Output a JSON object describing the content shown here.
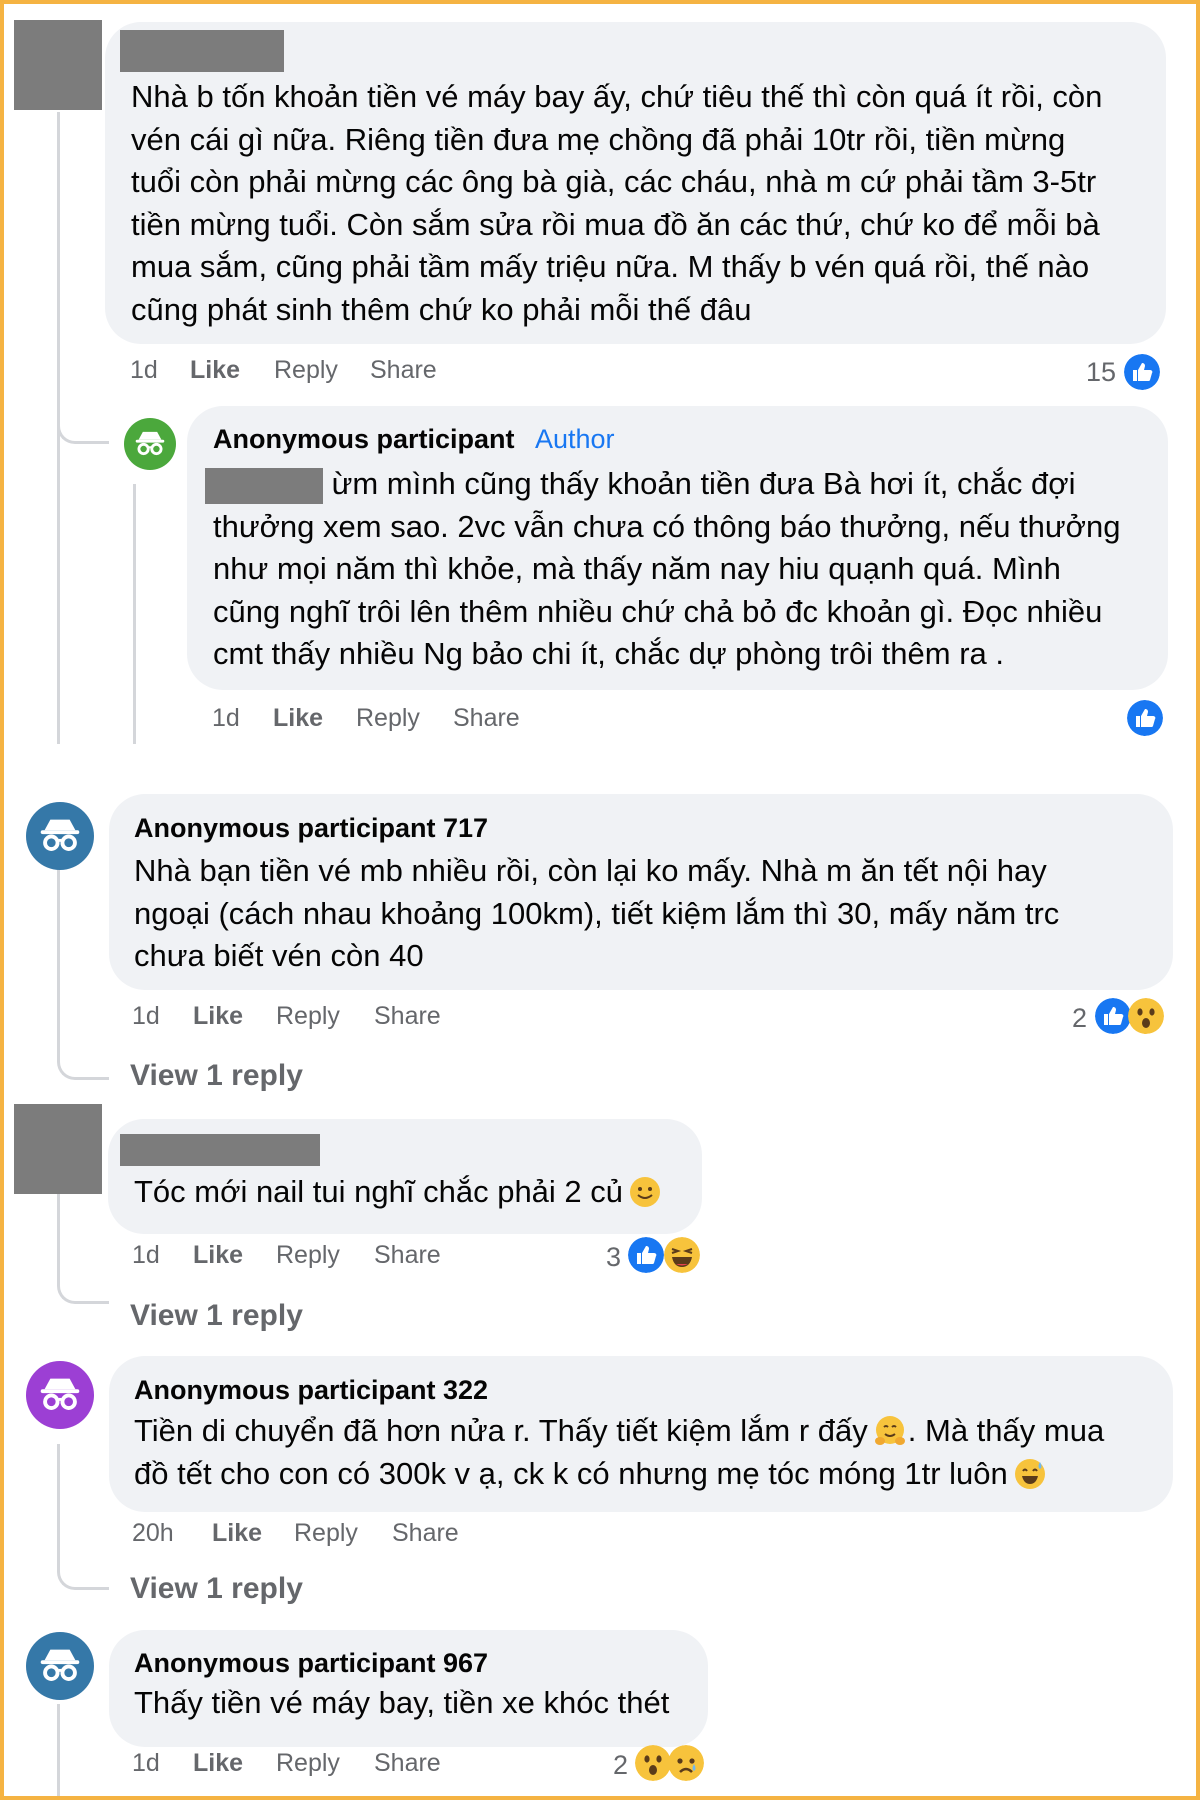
{
  "comments": [
    {
      "text_lines": [
        "Nhà b tốn khoản tiền vé máy bay ấy, chứ tiêu thế thì còn quá ít rồi, còn",
        "vén cái gì nữa. Riêng tiền đưa mẹ chồng đã phải 10tr rồi, tiền mừng",
        "tuổi còn phải mừng các ông bà già, các cháu, nhà m cứ phải tầm 3-5tr",
        "tiền mừng tuổi. Còn sắm sửa rồi mua đồ ăn các thứ, chứ ko để mỗi bà",
        "mua sắm, cũng phải tầm mấy triệu nữa. M thấy b vén quá rồi, thế nào",
        "cũng phát sinh thêm chứ ko phải mỗi thế đâu"
      ],
      "time": "1d",
      "like": "Like",
      "reply": "Share",
      "reply_label": "Reply",
      "share": "Share",
      "reaction_count": "15"
    },
    {
      "name": "Anonymous participant",
      "badge": "Author",
      "text_first": " ừm mình cũng thấy khoản tiền đưa Bà hơi ít, chắc đợi",
      "text_lines": [
        "thưởng xem sao. 2vc vẫn chưa có thông báo thưởng, nếu thưởng",
        "như mọi năm thì khỏe, mà thấy năm nay hiu quạnh quá. Mình",
        "cũng nghĩ trôi lên thêm nhiều chứ chả bỏ đc khoản gì. Đọc nhiều",
        "cmt thấy nhiều Ng bảo chi ít, chắc dự phòng trôi thêm ra ."
      ],
      "time": "1d",
      "like": "Like",
      "reply": "Reply",
      "share": "Share"
    },
    {
      "name": "Anonymous participant 717",
      "text_lines": [
        "Nhà bạn tiền vé mb nhiều rồi, còn lại ko mấy. Nhà m ăn tết nội hay",
        "ngoại (cách nhau khoảng 100km), tiết kiệm lắm thì 30, mấy năm trc",
        "chưa biết vén còn 40"
      ],
      "time": "1d",
      "like": "Like",
      "reply": "Reply",
      "share": "Share",
      "reaction_count": "2",
      "view_replies": "View 1 reply"
    },
    {
      "text_lines": [
        "Tóc mới nail tui nghĩ chắc phải 2 củ"
      ],
      "time": "1d",
      "like": "Like",
      "reply": "Reply",
      "share": "Share",
      "reaction_count": "3",
      "view_replies": "View 1 reply"
    },
    {
      "name": "Anonymous participant 322",
      "text_line1_a": "Tiền di chuyển đã hơn nửa r. Thấy tiết kiệm lắm r đấy",
      "text_line1_b": ". Mà thấy mua",
      "text_line2": "đồ tết cho con có 300k v ạ, ck k có nhưng mẹ tóc móng 1tr luôn",
      "time": "20h",
      "like": "Like",
      "reply": "Reply",
      "share": "Share",
      "view_replies": "View 1 reply"
    },
    {
      "name": "Anonymous participant 967",
      "text_lines": [
        "Thấy tiền vé máy bay, tiền xe khóc thét"
      ],
      "time": "1d",
      "like": "Like",
      "reply": "Reply",
      "share": "Share",
      "reaction_count": "2"
    }
  ],
  "colors": {
    "frame": "#f5b342",
    "bubble": "#f0f2f5",
    "link_blue": "#1877f2",
    "secondary_text": "#65676b",
    "avatar_green": "#4ba83c",
    "avatar_blue": "#3578a8",
    "avatar_purple": "#9c3fd4",
    "redaction_gray": "#7c7c7c"
  },
  "icons": [
    "incognito-avatar-icon",
    "like-reaction-icon",
    "wow-reaction-icon",
    "haha-reaction-icon",
    "sad-reaction-icon",
    "smile-emoji",
    "hugging-emoji",
    "sweat-smile-emoji"
  ]
}
